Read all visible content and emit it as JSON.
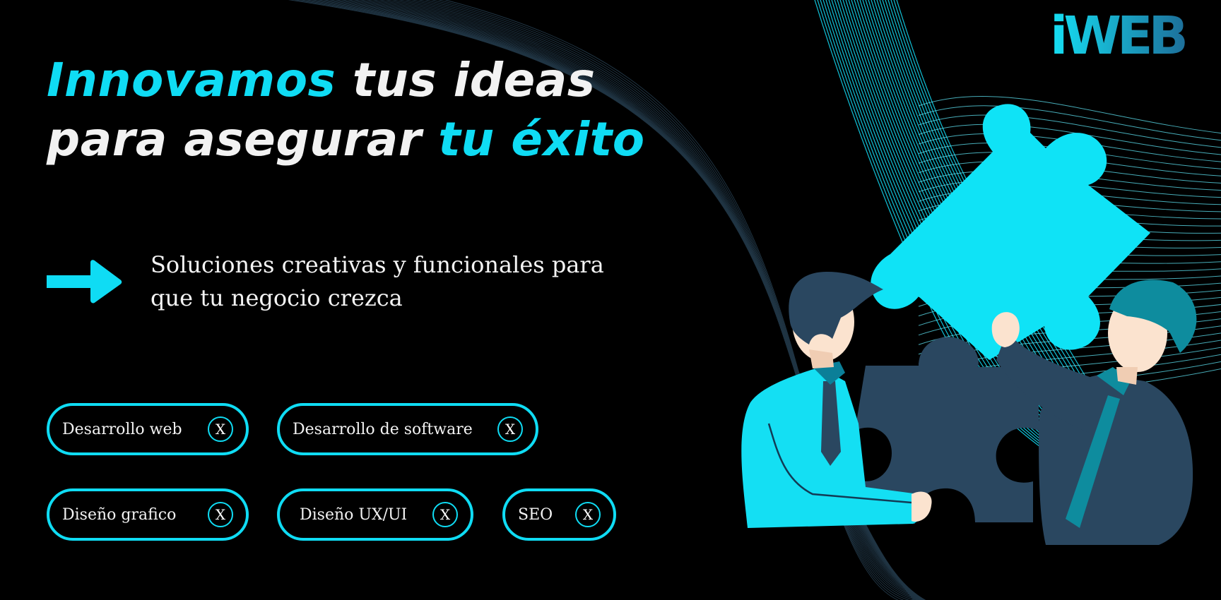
{
  "headline": {
    "line1_accent": "Innovamos",
    "line1_rest": " tus ideas",
    "line2_rest": "para asegurar ",
    "line2_accent": "tu éxito"
  },
  "subtitle": {
    "line1": "Soluciones creativas y funcionales para",
    "line2": "que tu negocio crezca"
  },
  "chips": [
    {
      "label": "Desarrollo web",
      "close": "X"
    },
    {
      "label": "Desarrollo de software",
      "close": "X"
    },
    {
      "label": "Diseño grafico",
      "close": "X"
    },
    {
      "label": "Diseño UX/UI",
      "close": "X"
    },
    {
      "label": "SEO",
      "close": "X"
    }
  ],
  "logo": {
    "text": "iWEB"
  },
  "icons": {
    "arrow": "arrow-right-icon",
    "chip_close": "close-icon",
    "illustration": "puzzle-teamwork-illustration"
  },
  "colors": {
    "background": "#000000",
    "accent": "#0fdcf4",
    "navy": "#2a4760",
    "text": "#f2f2f2"
  }
}
